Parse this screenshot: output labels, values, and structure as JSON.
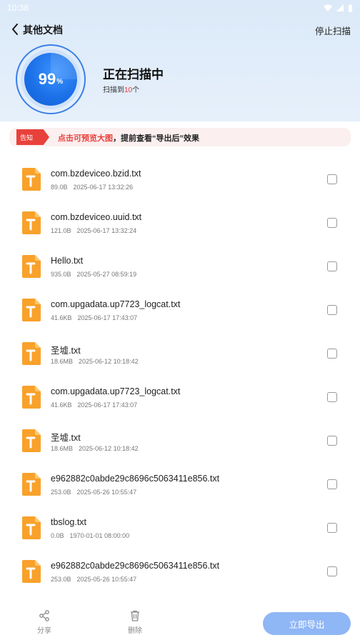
{
  "status_bar": {
    "time": "10:38"
  },
  "nav": {
    "title": "其他文档",
    "action": "停止扫描"
  },
  "scan": {
    "percent": "99",
    "percent_symbol": "%",
    "title": "正在扫描中",
    "sub_prefix": "扫描到",
    "count": "10",
    "sub_suffix": "个"
  },
  "notice": {
    "tag": "告知",
    "highlight": "点击可预览大图",
    "rest": "，提前查看“导出后”效果"
  },
  "files": [
    {
      "name": "com.bzdeviceo.bzid.txt",
      "size": "89.0B",
      "time": "2025-06-17 13:32:26",
      "icon": "txt-file-icon",
      "checked": false
    },
    {
      "name": "com.bzdeviceo.uuid.txt",
      "size": "121.0B",
      "time": "2025-06-17 13:32:24",
      "icon": "txt-file-icon",
      "checked": false
    },
    {
      "name": "Hello.txt",
      "size": "935.0B",
      "time": "2025-05-27 08:59:19",
      "icon": "txt-file-icon",
      "checked": false
    },
    {
      "name": "com.upgadata.up7723_logcat.txt",
      "size": "41.6KB",
      "time": "2025-06-17 17:43:07",
      "icon": "txt-file-icon",
      "checked": false
    },
    {
      "name": "圣墟.txt",
      "size": "18.6MB",
      "time": "2025-06-12 10:18:42",
      "icon": "txt-file-icon",
      "checked": false
    },
    {
      "name": "com.upgadata.up7723_logcat.txt",
      "size": "41.6KB",
      "time": "2025-06-17 17:43:07",
      "icon": "txt-file-icon",
      "checked": false
    },
    {
      "name": "圣墟.txt",
      "size": "18.6MB",
      "time": "2025-06-12 10:18:42",
      "icon": "txt-file-icon",
      "checked": false
    },
    {
      "name": "e962882c0abde29c8696c5063411e856.txt",
      "size": "253.0B",
      "time": "2025-05-26 10:55:47",
      "icon": "txt-file-icon",
      "checked": false
    },
    {
      "name": "tbslog.txt",
      "size": "0.0B",
      "time": "1970-01-01 08:00:00",
      "icon": "txt-file-icon",
      "checked": false
    },
    {
      "name": "e962882c0abde29c8696c5063411e856.txt",
      "size": "253.0B",
      "time": "2025-05-26 10:55:47",
      "icon": "txt-file-icon",
      "checked": false
    }
  ],
  "bottom": {
    "share_label": "分享",
    "delete_label": "删除",
    "export_label": "立即导出"
  },
  "colors": {
    "accent": "#1a6ee6",
    "warning": "#e8413b",
    "file_icon": "#f9a12a",
    "export_button": "#8fb6f5"
  }
}
